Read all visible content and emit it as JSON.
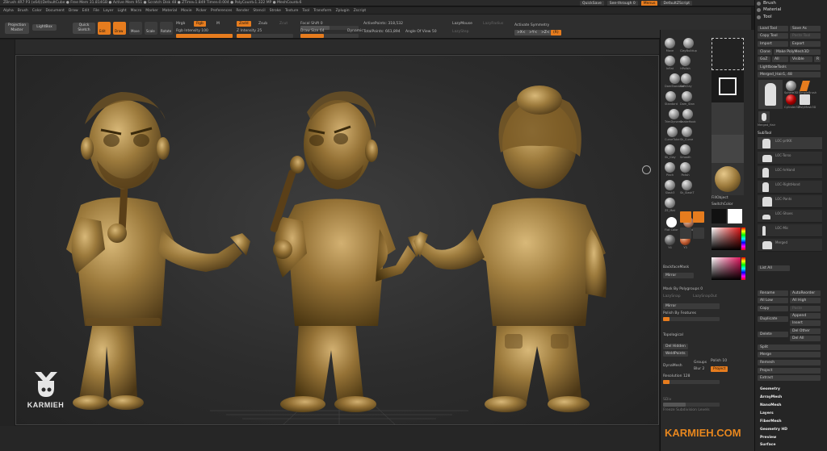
{
  "app": {
    "title_bar": "ZBrush 4R7 P3 (x64)(DefaultCube  ●  Free Mem 31.814GB  ●  Active Mem 951  ●  Scratch Disk 48  ●  ZTime▹1.849 Timer▹0.004  ●  PolyCount▹1.322 MP  ●  MeshCount▹6",
    "quick_save": "QuickSave",
    "see_through": "See-through  0",
    "menus_label": "Menus",
    "default_zscript": "DefaultZScript"
  },
  "menus": [
    "Alpha",
    "Brush",
    "Color",
    "Document",
    "Draw",
    "Edit",
    "File",
    "Layer",
    "Light",
    "Macro",
    "Marker",
    "Material",
    "Movie",
    "Picker",
    "Preferences",
    "Render",
    "Stencil",
    "Stroke",
    "Texture",
    "Tool",
    "Transform",
    "Zplugin",
    "Zscript"
  ],
  "shelf": {
    "projection_master": "Projection Master",
    "lightbox": "LightBox",
    "quick_sketch": "Quick Sketch",
    "edit": "Edit",
    "draw": "Draw",
    "move": "Move",
    "scale": "Scale",
    "rotate": "Rotate",
    "mrgb": "Mrgb",
    "rgb": "Rgb",
    "m": "M",
    "rgb_intensity": "Rgb Intensity 100",
    "zadd": "Zadd",
    "zsub": "Zsub",
    "zcut": "Zcut",
    "z_intensity": "Z Intensity 25",
    "focal_shift": "Focal Shift 0",
    "draw_size": "Draw Size 64",
    "dynamic": "Dynamic",
    "active_points": "ActivePoints: 318,532",
    "total_points": "TotalPoints: 661,894",
    "angle_of_view": "Angle Of View 50",
    "lazymouse": "LazyMouse",
    "lazyradius": "LazyRadius",
    "lazystep": "LazyStep",
    "activate_symmetry": "Activate Symmetry",
    "x": ">X<",
    "y": ">Y<",
    "z": ">Z<",
    "r": "(R)"
  },
  "palette": {
    "brushes": [
      "Move",
      "ClayBuildup",
      "Inflat",
      "hPolish",
      "DamStandard",
      "SoftClay",
      "Standard",
      "Dam_Stan",
      "TrimDynamic",
      "SnakeHook",
      "CurveTube",
      "Sk_Curve",
      "Sk_Clay",
      "Smooth",
      "Pinch",
      "Polish",
      "Slash3",
      "Sk_SlashT",
      "ZE_Mat"
    ],
    "materials": [
      "Flat Color",
      "SkinShade4",
      "Y4",
      "Y3"
    ],
    "fill_object": "FillObject",
    "switch_color": "SwitchColor",
    "backface_mask": "BackfaceMask",
    "mirror": "Mirror",
    "mask_by_polygroups": "Mask By Polygroups 0",
    "lazy_snap": "LazySnap",
    "lazy_snap_out": "LazySnapOut",
    "mirror2": "Mirror",
    "polish_by_features": "Polish By Features",
    "topological": "Topological",
    "del_hidden": "Del Hidden",
    "weld_points": "WeldPoints",
    "dynamesh": "DynaMesh",
    "groups": "Groups",
    "polish": "Polish 10",
    "blur": "Blur 2",
    "project": "Project",
    "resolution": "Resolution 128",
    "sdiv": "SDiv",
    "freeze_subdivision": "Freeze Subdivision Levels",
    "colors": {
      "accent": "#e67c1e",
      "panel": "#2a2a2a"
    }
  },
  "tray": {
    "brush": "Brush",
    "material": "Material",
    "tool": "Tool",
    "load_tool": "Load Tool",
    "save_as": "Save As",
    "copy_tool": "Copy Tool",
    "paste_tool": "Paste Tool",
    "import": "Import",
    "export": "Export",
    "clone": "Clone",
    "make_polymesh": "Make PolyMesh3D",
    "goz": "GoZ",
    "all": "All",
    "visible": "Visible",
    "r": "R",
    "lightbox_tools": "Lightbox▸Tools",
    "merged_label": "Merged_Hair1, 48",
    "tool_thumbs": [
      "Merged_Hair",
      "Sphere3D",
      "SimpleBrush",
      "Cylinder3D",
      "PolyMesh3D",
      "Cube3D"
    ],
    "subtool_header": "SubTool",
    "subtools": [
      "LOC-prtKK",
      "LOC-Torso",
      "LOC-hrHand",
      "LOC-RightHand",
      "LOC-Pants",
      "LOC-Shoes",
      "LOC-Mic"
    ],
    "merged_sub": "Merged",
    "list_all": "List All",
    "rename": "Rename",
    "autoreorder": "AutoReorder",
    "all_low": "All Low",
    "all_high": "All High",
    "copy": "Copy",
    "paste": "Paste",
    "duplicate": "Duplicate",
    "append": "Append",
    "insert": "Insert",
    "delete": "Delete",
    "del_other": "Del Other",
    "del_all": "Del All",
    "split": "Split",
    "merge": "Merge",
    "remesh": "Remesh",
    "project": "Project",
    "extract": "Extract",
    "sections": [
      "Geometry",
      "ArrayMesh",
      "NanoMesh",
      "Layers",
      "FiberMesh",
      "Geometry HD",
      "Preview",
      "Surface"
    ]
  },
  "branding": {
    "name": "KARMIEH",
    "url": "KARMIEH.COM",
    "accent": "#e8871e"
  }
}
